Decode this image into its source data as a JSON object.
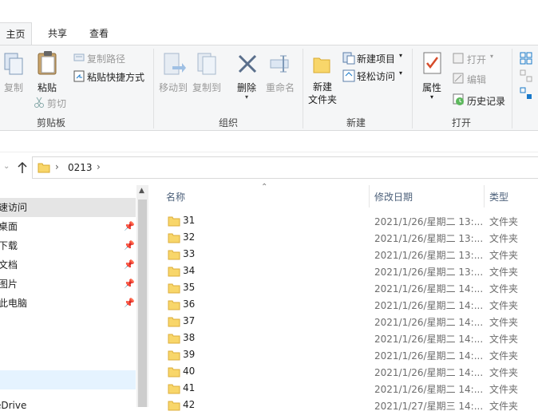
{
  "ribbon": {
    "tabs": [
      "主页",
      "共享",
      "查看"
    ],
    "clipboard": {
      "copy": "复制",
      "paste": "粘贴",
      "copy_path": "复制路径",
      "paste_shortcut": "粘贴快捷方式",
      "cut": "剪切",
      "label": "剪贴板"
    },
    "organize": {
      "move_to": "移动到",
      "copy_to": "复制到",
      "delete": "删除",
      "rename": "重命名",
      "label": "组织"
    },
    "new": {
      "new_folder_line1": "新建",
      "new_folder_line2": "文件夹",
      "new_item": "新建项目",
      "easy_access": "轻松访问",
      "label": "新建"
    },
    "open": {
      "properties": "属性",
      "open": "打开",
      "edit": "编辑",
      "history": "历史记录",
      "label": "打开"
    }
  },
  "address": {
    "path": "0213",
    "separator": "›"
  },
  "nav": {
    "items": [
      {
        "label": "速访问",
        "pinned": false
      },
      {
        "label": "桌面",
        "pinned": true
      },
      {
        "label": "下载",
        "pinned": true
      },
      {
        "label": "文档",
        "pinned": true
      },
      {
        "label": "图片",
        "pinned": true
      },
      {
        "label": "此电脑",
        "pinned": true
      },
      {
        "label": "eDrive",
        "pinned": false
      }
    ]
  },
  "list": {
    "headers": {
      "name": "名称",
      "date": "修改日期",
      "type": "类型"
    },
    "rows": [
      {
        "name": "31",
        "date": "2021/1/26/星期二 13:...",
        "type": "文件夹"
      },
      {
        "name": "32",
        "date": "2021/1/26/星期二 13:...",
        "type": "文件夹"
      },
      {
        "name": "33",
        "date": "2021/1/26/星期二 13:...",
        "type": "文件夹"
      },
      {
        "name": "34",
        "date": "2021/1/26/星期二 13:...",
        "type": "文件夹"
      },
      {
        "name": "35",
        "date": "2021/1/26/星期二 14:...",
        "type": "文件夹"
      },
      {
        "name": "36",
        "date": "2021/1/26/星期二 14:...",
        "type": "文件夹"
      },
      {
        "name": "37",
        "date": "2021/1/26/星期二 14:...",
        "type": "文件夹"
      },
      {
        "name": "38",
        "date": "2021/1/26/星期二 14:...",
        "type": "文件夹"
      },
      {
        "name": "39",
        "date": "2021/1/26/星期二 14:...",
        "type": "文件夹"
      },
      {
        "name": "40",
        "date": "2021/1/26/星期二 14:...",
        "type": "文件夹"
      },
      {
        "name": "41",
        "date": "2021/1/26/星期二 14:...",
        "type": "文件夹"
      },
      {
        "name": "42",
        "date": "2021/1/27/星期三 14:...",
        "type": "文件夹"
      }
    ]
  },
  "colors": {
    "folder": "#f8d66a",
    "accent": "#1979ca",
    "ribbon_bg": "#f5f6f7",
    "nav_selected": "#e5e5e5",
    "nav_hover": "#e5f3ff"
  }
}
